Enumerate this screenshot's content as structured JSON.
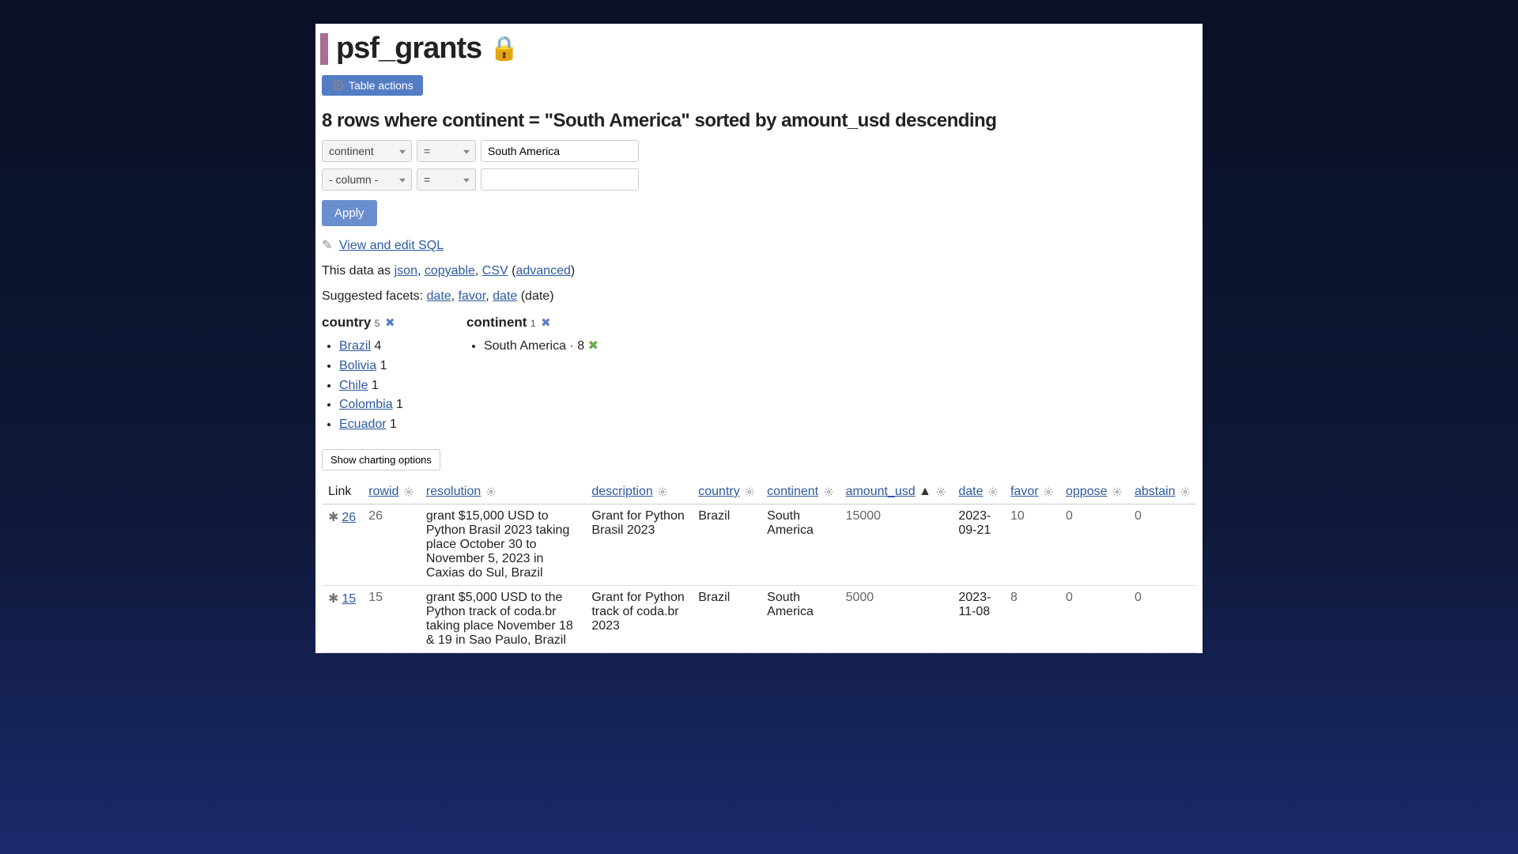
{
  "header": {
    "title": "psf_grants",
    "lock_icon": "🔒",
    "table_actions_label": "Table actions"
  },
  "query_summary": "8 rows where continent = \"South America\" sorted by amount_usd descending",
  "filters": [
    {
      "column": "continent",
      "op": "=",
      "value": "South America"
    },
    {
      "column": "- column -",
      "op": "=",
      "value": ""
    }
  ],
  "apply_label": "Apply",
  "sql_link": {
    "pencil": "✎",
    "label": "View and edit SQL"
  },
  "export_line": {
    "prefix": "This data as ",
    "json": "json",
    "copyable": "copyable",
    "csv": "CSV",
    "advanced": "advanced"
  },
  "suggested_facets": {
    "prefix": "Suggested facets: ",
    "items": [
      "date",
      "favor",
      "date"
    ],
    "suffix": " (date)"
  },
  "facets": {
    "country": {
      "label": "country",
      "count": "5",
      "clear": "✖",
      "items": [
        {
          "name": "Brazil",
          "n": "4"
        },
        {
          "name": "Bolivia",
          "n": "1"
        },
        {
          "name": "Chile",
          "n": "1"
        },
        {
          "name": "Colombia",
          "n": "1"
        },
        {
          "name": "Ecuador",
          "n": "1"
        }
      ]
    },
    "continent": {
      "label": "continent",
      "count": "1",
      "clear": "✖",
      "active": {
        "name": "South America",
        "n": "8",
        "remove": "✖"
      }
    }
  },
  "charting_label": "Show charting options",
  "table": {
    "headers": {
      "link": "Link",
      "rowid": "rowid",
      "resolution": "resolution",
      "description": "description",
      "country": "country",
      "continent": "continent",
      "amount_usd": "amount_usd",
      "sort_arrow": "▲",
      "date": "date",
      "favor": "favor",
      "oppose": "oppose",
      "abstain": "abstain"
    },
    "rows": [
      {
        "pk": "26",
        "rowid": "26",
        "resolution": "grant $15,000 USD to Python Brasil 2023 taking place October 30 to November 5, 2023 in Caxias do Sul, Brazil",
        "description": "Grant for Python Brasil 2023",
        "country": "Brazil",
        "continent": "South America",
        "amount_usd": "15000",
        "date": "2023-09-21",
        "favor": "10",
        "oppose": "0",
        "abstain": "0"
      },
      {
        "pk": "15",
        "rowid": "15",
        "resolution": "grant $5,000 USD to the Python track of coda.br taking place November 18 & 19 in Sao Paulo, Brazil",
        "description": "Grant for Python track of coda.br 2023",
        "country": "Brazil",
        "continent": "South America",
        "amount_usd": "5000",
        "date": "2023-11-08",
        "favor": "8",
        "oppose": "0",
        "abstain": "0"
      }
    ]
  }
}
